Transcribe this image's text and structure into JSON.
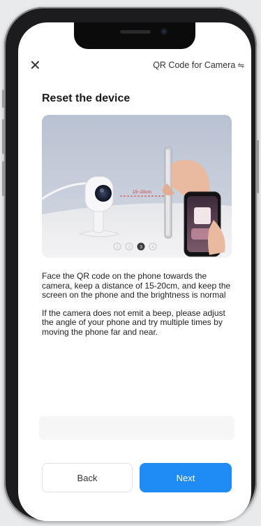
{
  "header": {
    "close_icon": "close-icon",
    "qr_link_label": "QR Code for Camera",
    "qr_link_icon": "swap-arrows-icon",
    "qr_link_arrow": "⇋"
  },
  "page": {
    "title": "Reset the device"
  },
  "illustration": {
    "distance_label": "15~20cm",
    "pager": {
      "pages": [
        "1",
        "2",
        "3",
        "4"
      ],
      "active": "3"
    }
  },
  "instructions": {
    "paragraph_1": "Face the QR code on the phone towards the camera, keep a distance of 15-20cm, and keep the screen on the phone and the brightness is normal",
    "paragraph_2": "If the camera does not emit a beep, please adjust the angle of your phone and try multiple times by moving the phone far and near."
  },
  "footer": {
    "back_label": "Back",
    "next_label": "Next"
  },
  "colors": {
    "primary": "#1f8cf5",
    "text": "#222222",
    "background": "#ffffff"
  }
}
